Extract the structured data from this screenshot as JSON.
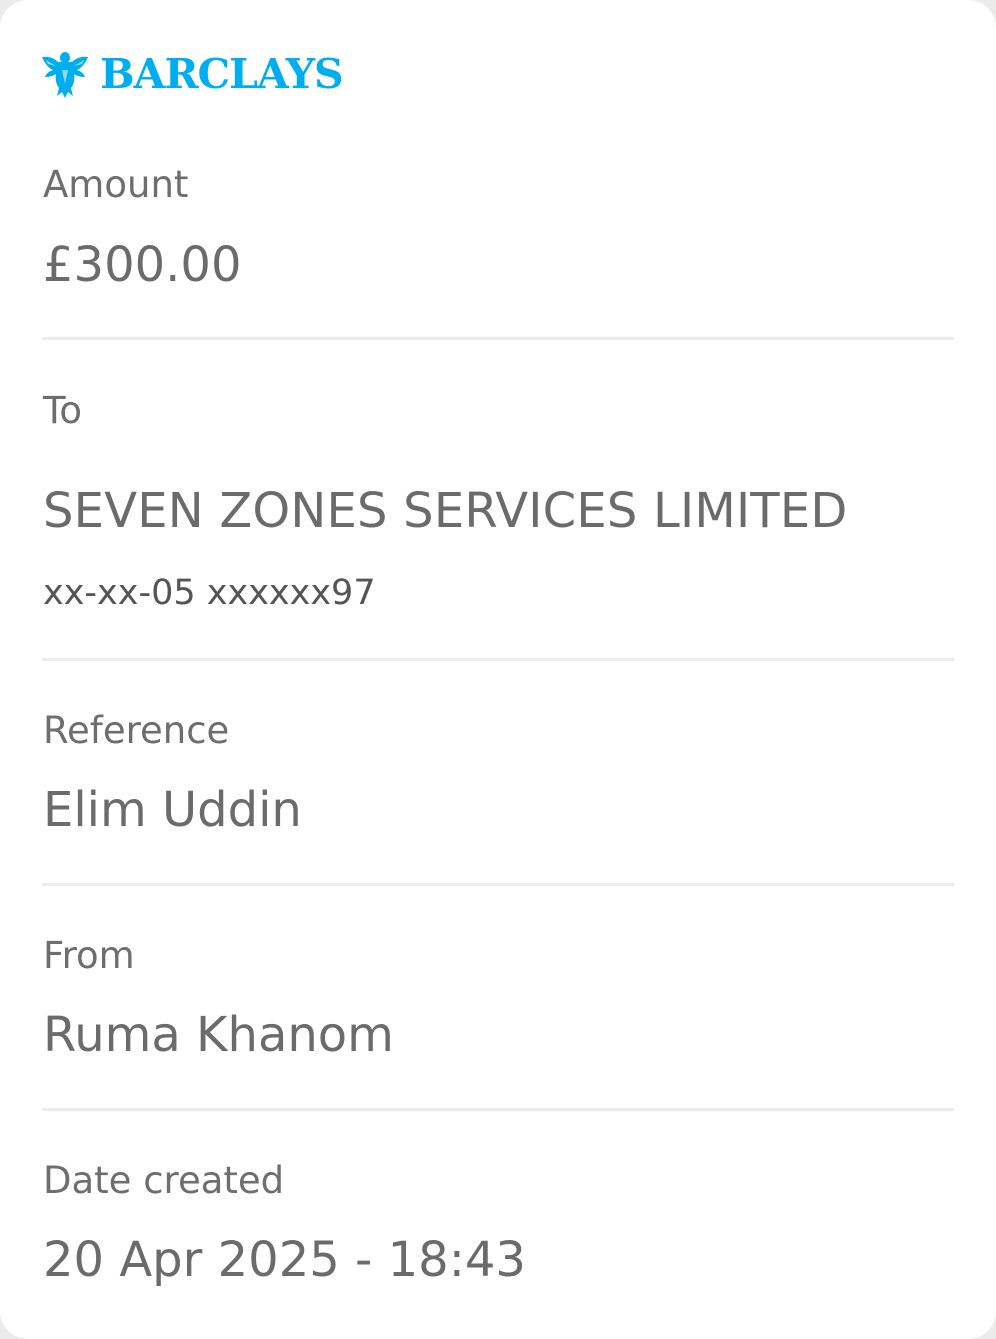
{
  "brand": {
    "name": "BARCLAYS",
    "color": "#00aeef",
    "icon": "eagle-icon"
  },
  "details": {
    "amount": {
      "label": "Amount",
      "value": "£300.00"
    },
    "to": {
      "label": "To",
      "value": "SEVEN ZONES SERVICES LIMITED",
      "account": "xx-xx-05 xxxxxx97"
    },
    "reference": {
      "label": "Reference",
      "value": "Elim Uddin"
    },
    "from": {
      "label": "From",
      "value": "Ruma Khanom"
    },
    "date_created": {
      "label": "Date created",
      "value": "20 Apr 2025 - 18:43"
    }
  },
  "colors": {
    "text_label": "#6e6e6e",
    "text_value": "#6b6b6b",
    "divider": "#ececec",
    "background": "#ffffff"
  }
}
